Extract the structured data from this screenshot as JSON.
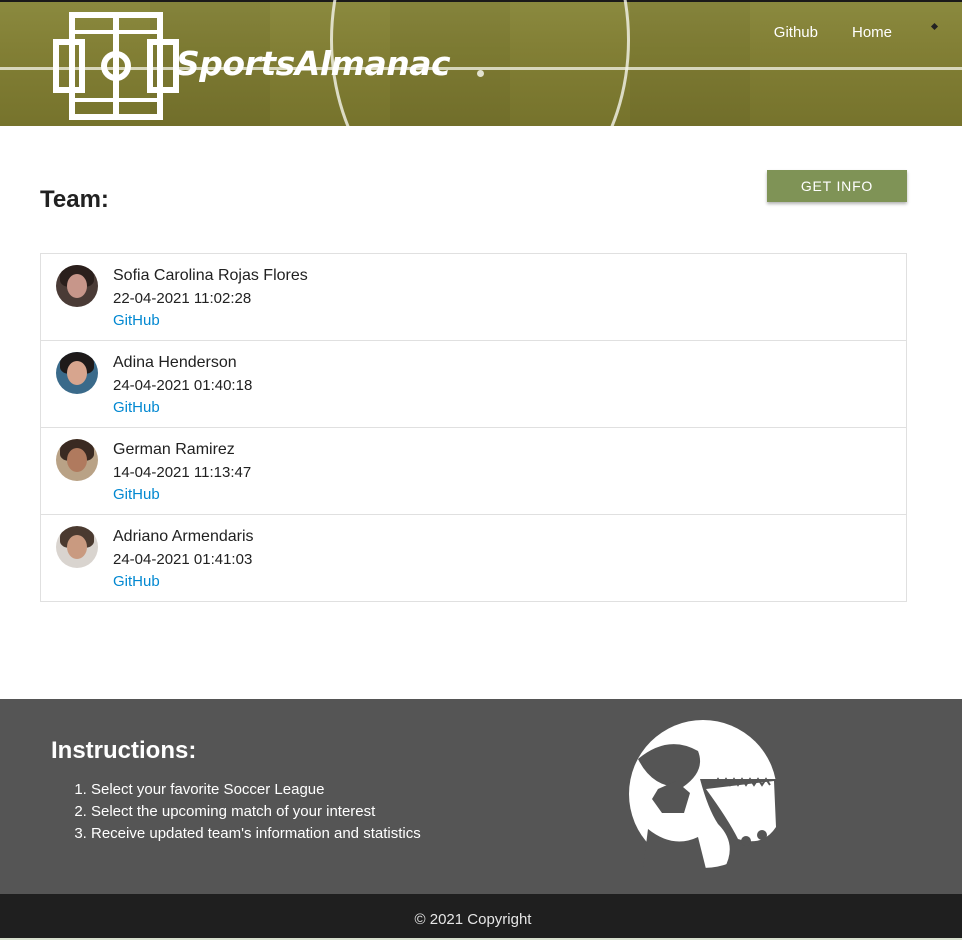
{
  "header": {
    "brand": "SportsAlmanac",
    "nav": [
      {
        "label": "Github"
      },
      {
        "label": "Home"
      }
    ]
  },
  "main": {
    "title": "Team:",
    "get_info_label": "GET INFO",
    "members": [
      {
        "name": "Sofia Carolina Rojas Flores",
        "date": "22-04-2021 11:02:28",
        "link": "GitHub"
      },
      {
        "name": "Adina Henderson",
        "date": "24-04-2021 01:40:18",
        "link": "GitHub"
      },
      {
        "name": "German Ramirez",
        "date": "14-04-2021 11:13:47",
        "link": "GitHub"
      },
      {
        "name": "Adriano Armendaris",
        "date": "24-04-2021 01:41:03",
        "link": "GitHub"
      }
    ]
  },
  "footer": {
    "instructions_title": "Instructions:",
    "steps": [
      "Select your favorite Soccer League",
      "Select the upcoming match of your interest",
      "Receive updated team's information and statistics"
    ],
    "copyright": "© 2021 Copyright"
  },
  "colors": {
    "accent_button": "#7f9356",
    "link": "#0288d1",
    "footer_bg": "#555555",
    "copyright_bg": "#1f1f1f",
    "header_field": "#827f35"
  },
  "icons": {
    "logo": "soccer-field-icon",
    "footer": "soccer-ball-cleat-icon"
  }
}
